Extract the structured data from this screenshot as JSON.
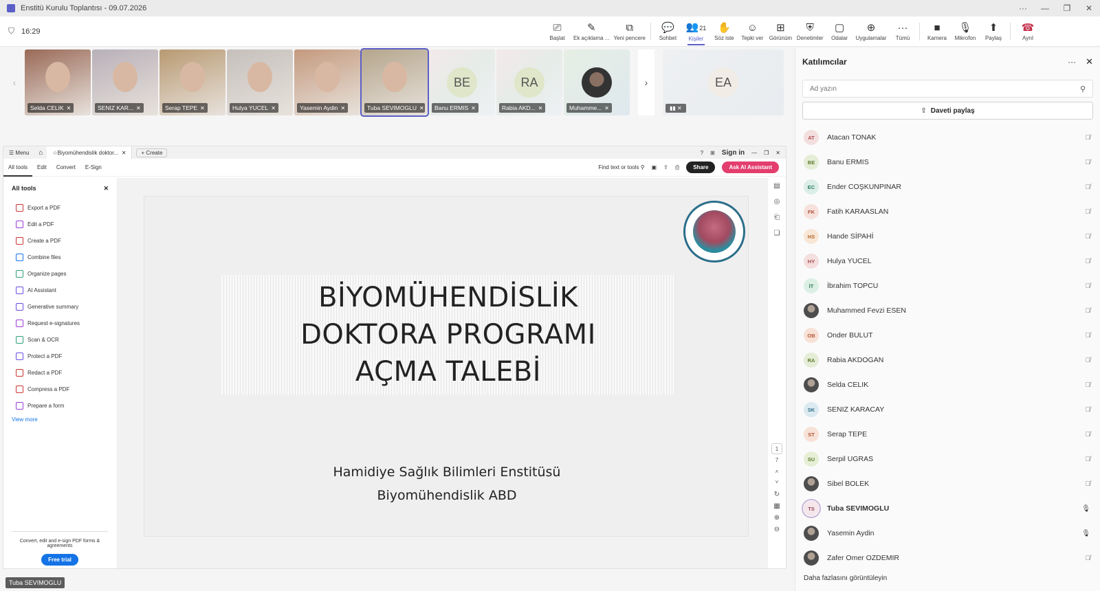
{
  "window": {
    "title": "Enstitü Kurulu Toplantısı - 09.07.2026",
    "controls": [
      "···",
      "—",
      "❐",
      "✕"
    ]
  },
  "toolbar": {
    "time": "16:29",
    "buttons": [
      {
        "label": "Başlat",
        "icon": "record-icon"
      },
      {
        "label": "Ek açıklama ...",
        "icon": "pen-icon"
      },
      {
        "label": "Yeni pencere",
        "icon": "popout-icon"
      },
      {
        "label": "Sohbet",
        "icon": "chat-icon"
      },
      {
        "label": "Kişiler",
        "icon": "people-icon",
        "count": "21"
      },
      {
        "label": "Söz iste",
        "icon": "raise-hand-icon"
      },
      {
        "label": "Tepki ver",
        "icon": "emoji-icon"
      },
      {
        "label": "Görünüm",
        "icon": "grid-icon"
      },
      {
        "label": "Denetimler",
        "icon": "shield-gear-icon"
      },
      {
        "label": "Odalar",
        "icon": "rooms-icon"
      },
      {
        "label": "Uygulamalar",
        "icon": "apps-icon"
      },
      {
        "label": "Tümü",
        "icon": "more-icon"
      },
      {
        "label": "Kamera",
        "icon": "camera-off-icon"
      },
      {
        "label": "Mikrofon",
        "icon": "mic-off-icon"
      },
      {
        "label": "Paylaş",
        "icon": "share-icon"
      },
      {
        "label": "Ayrıl",
        "icon": "hangup-icon"
      }
    ]
  },
  "strip": {
    "tiles": [
      {
        "name": "Selda CELIK",
        "bg": "#9a6a58"
      },
      {
        "name": "SENIZ KAR...",
        "bg": "#b8b0b8"
      },
      {
        "name": "Serap TEPE",
        "bg": "#b89a72"
      },
      {
        "name": "Hulya YUCEL",
        "bg": "#c6c0bc"
      },
      {
        "name": "Yasemin Aydin",
        "bg": "#c49a7e"
      },
      {
        "name": "Tuba SEVIMOGLU",
        "bg": "#b5a68c"
      },
      {
        "name": "Banu ERMIS",
        "initials": "BE"
      },
      {
        "name": "Rabia AKD...",
        "initials": "RA"
      },
      {
        "name": "Muhamme...",
        "photo": true
      }
    ],
    "extra": {
      "initials": "EA"
    }
  },
  "acrobat": {
    "tab": "Biyomühendislik doktor...",
    "create": "Create",
    "menu_label": "Menu",
    "signin": "Sign in",
    "menus": [
      "All tools",
      "Edit",
      "Convert",
      "E-Sign"
    ],
    "find": "Find text or tools",
    "share": "Share",
    "ai": "Ask AI Assistant",
    "tools_head": "All tools",
    "tools": [
      "Export a PDF",
      "Edit a PDF",
      "Create a PDF",
      "Combine files",
      "Organize pages",
      "AI Assistant",
      "Generative summary",
      "Request e-signatures",
      "Scan & OCR",
      "Protect a PDF",
      "Redact a PDF",
      "Compress a PDF",
      "Prepare a form"
    ],
    "view_more": "View more",
    "promo": "Convert, edit and e-sign PDF forms & agreements",
    "trial": "Free trial",
    "page_current": "1",
    "page_total": "7",
    "slide": {
      "title_lines": [
        "BİYOMÜHENDİSLİK",
        "DOKTORA PROGRAMI",
        "AÇMA TALEBİ"
      ],
      "sub1": "Hamidiye Sağlık Bilimleri Enstitüsü",
      "sub2": "Biyomühendislik ABD"
    }
  },
  "speaker": "Tuba SEVIMOGLU",
  "panel": {
    "title": "Katılımcılar",
    "search_placeholder": "Ad yazın",
    "invite": "Daveti paylaş",
    "participants": [
      {
        "initials": "AT",
        "name": "Atacan TONAK",
        "color": "#f3dede",
        "fg": "#b04d4d",
        "mic": "off"
      },
      {
        "initials": "BE",
        "name": "Banu ERMIS",
        "color": "#e5edd6",
        "fg": "#5d7a2e",
        "mic": "off"
      },
      {
        "initials": "EC",
        "name": "Ender COŞKUNPINAR",
        "color": "#dbeee8",
        "fg": "#2e7a60",
        "mic": "off"
      },
      {
        "initials": "FK",
        "name": "Fatih KARAASLAN",
        "color": "#f7e1dc",
        "fg": "#b0503d",
        "mic": "off"
      },
      {
        "initials": "HS",
        "name": "Hande SİPAHİ",
        "color": "#f8e6d6",
        "fg": "#b06a2a",
        "mic": "off"
      },
      {
        "initials": "HY",
        "name": "Hulya YUCEL",
        "color": "#f4dede",
        "fg": "#a84c4c",
        "mic": "off"
      },
      {
        "initials": "İT",
        "name": "İbrahim TOPCU",
        "color": "#dcefe5",
        "fg": "#2e7a52",
        "mic": "off"
      },
      {
        "initials": "",
        "name": "Muhammed Fevzi ESEN",
        "photo": true,
        "mic": "off"
      },
      {
        "initials": "OB",
        "name": "Onder BULUT",
        "color": "#f8e1d6",
        "fg": "#b0593a",
        "mic": "off"
      },
      {
        "initials": "RA",
        "name": "Rabia AKDOGAN",
        "color": "#e5edd6",
        "fg": "#5d7a2e",
        "mic": "off"
      },
      {
        "initials": "",
        "name": "Selda CELIK",
        "photo": true,
        "mic": "off"
      },
      {
        "initials": "SK",
        "name": "SENIZ KARACAY",
        "color": "#dbeaf0",
        "fg": "#2e6f87",
        "mic": "off"
      },
      {
        "initials": "ST",
        "name": "Serap TEPE",
        "color": "#f8e1d6",
        "fg": "#b0593a",
        "mic": "off"
      },
      {
        "initials": "SU",
        "name": "Serpil UGRAS",
        "color": "#e6efd6",
        "fg": "#5d7a2e",
        "mic": "off"
      },
      {
        "initials": "",
        "name": "Sibel BOLEK",
        "photo": true,
        "mic": "off"
      },
      {
        "initials": "TS",
        "name": "Tuba SEVIMOGLU",
        "color": "#f4e6ea",
        "fg": "#9a4d62",
        "mic": "on",
        "bold": true,
        "ring": true
      },
      {
        "initials": "",
        "name": "Yasemin Aydin",
        "photo": true,
        "mic": "on"
      },
      {
        "initials": "",
        "name": "Zafer Omer OZDEMIR",
        "photo": true,
        "mic": "off"
      }
    ],
    "see_more": "Daha fazlasını görüntüleyin"
  }
}
